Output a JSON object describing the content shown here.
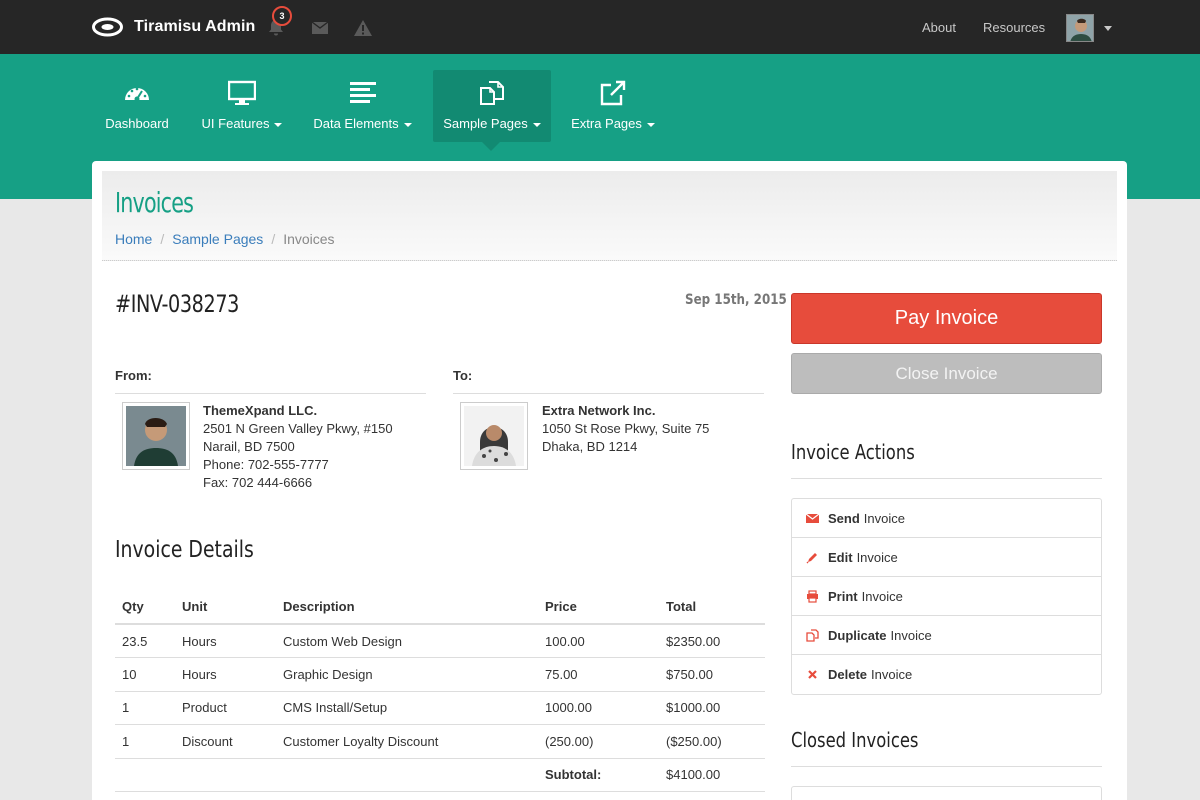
{
  "app": {
    "name": "Tiramisu Admin",
    "notification_count": "3"
  },
  "topnav": {
    "about": "About",
    "resources": "Resources"
  },
  "mainnav": [
    {
      "label": "Dashboard",
      "icon": "dashboard-icon",
      "dropdown": false
    },
    {
      "label": "UI Features",
      "icon": "monitor-icon",
      "dropdown": true
    },
    {
      "label": "Data Elements",
      "icon": "align-left-icon",
      "dropdown": true
    },
    {
      "label": "Sample Pages",
      "icon": "copy-icon",
      "dropdown": true,
      "active": true
    },
    {
      "label": "Extra Pages",
      "icon": "external-link-icon",
      "dropdown": true
    }
  ],
  "page": {
    "title": "Invoices",
    "breadcrumb": [
      "Home",
      "Sample Pages",
      "Invoices"
    ]
  },
  "invoice": {
    "number": "#INV-038273",
    "date": "Sep 15th, 2015",
    "from_label": "From:",
    "to_label": "To:",
    "from": {
      "name": "ThemeXpand LLC.",
      "line1": "2501 N Green Valley Pkwy, #150",
      "line2": "Narail, BD 7500",
      "phone": "Phone: 702-555-7777",
      "fax": "Fax: 702 444-6666"
    },
    "to": {
      "name": "Extra Network Inc.",
      "line1": "1050 St Rose Pkwy, Suite 75",
      "line2": "Dhaka, BD 1214"
    },
    "details_title": "Invoice Details",
    "columns": [
      "Qty",
      "Unit",
      "Description",
      "Price",
      "Total"
    ],
    "rows": [
      [
        "23.5",
        "Hours",
        "Custom Web Design",
        "100.00",
        "$2350.00"
      ],
      [
        "10",
        "Hours",
        "Graphic Design",
        "75.00",
        "$750.00"
      ],
      [
        "1",
        "Product",
        "CMS Install/Setup",
        "1000.00",
        "$1000.00"
      ],
      [
        "1",
        "Discount",
        "Customer Loyalty Discount",
        "(250.00)",
        "($250.00)"
      ]
    ],
    "subtotal_label": "Subtotal:",
    "subtotal_value": "$4100.00"
  },
  "sidebar": {
    "pay_label": "Pay Invoice",
    "close_label": "Close Invoice",
    "actions_title": "Invoice Actions",
    "actions": [
      {
        "verb": "Send",
        "rest": "Invoice",
        "icon": "envelope-icon"
      },
      {
        "verb": "Edit",
        "rest": "Invoice",
        "icon": "pencil-icon"
      },
      {
        "verb": "Print",
        "rest": "Invoice",
        "icon": "print-icon"
      },
      {
        "verb": "Duplicate",
        "rest": "Invoice",
        "icon": "copy-icon"
      },
      {
        "verb": "Delete",
        "rest": "Invoice",
        "icon": "times-icon"
      }
    ],
    "closed_title": "Closed Invoices"
  },
  "colors": {
    "brand": "#16a085",
    "topbar": "#262626",
    "danger": "#e74c3c",
    "link": "#3a7dbb"
  }
}
